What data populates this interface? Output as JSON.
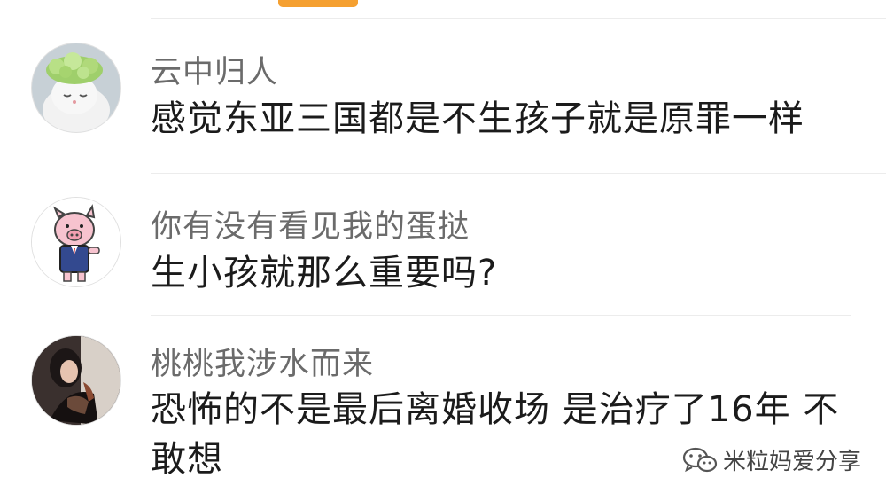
{
  "comments": [
    {
      "username": "云中归人",
      "text": "感觉东亚三国都是不生孩子就是原罪一样",
      "avatar_icon": "cat-with-lettuce-hat-icon"
    },
    {
      "username": "你有没有看见我的蛋挞",
      "text": "生小孩就那么重要吗?",
      "avatar_icon": "pig-in-suit-icon"
    },
    {
      "username": "桃桃我涉水而来",
      "text": "恐怖的不是最后离婚收场 是治疗了16年 不敢想",
      "avatar_icon": "woman-photo-icon"
    }
  ],
  "watermark": {
    "label": "米粒妈爱分享",
    "icon": "wechat-icon"
  },
  "colors": {
    "accent": "#f5a031",
    "username": "#6b6b6b",
    "text": "#1b1b1b"
  }
}
